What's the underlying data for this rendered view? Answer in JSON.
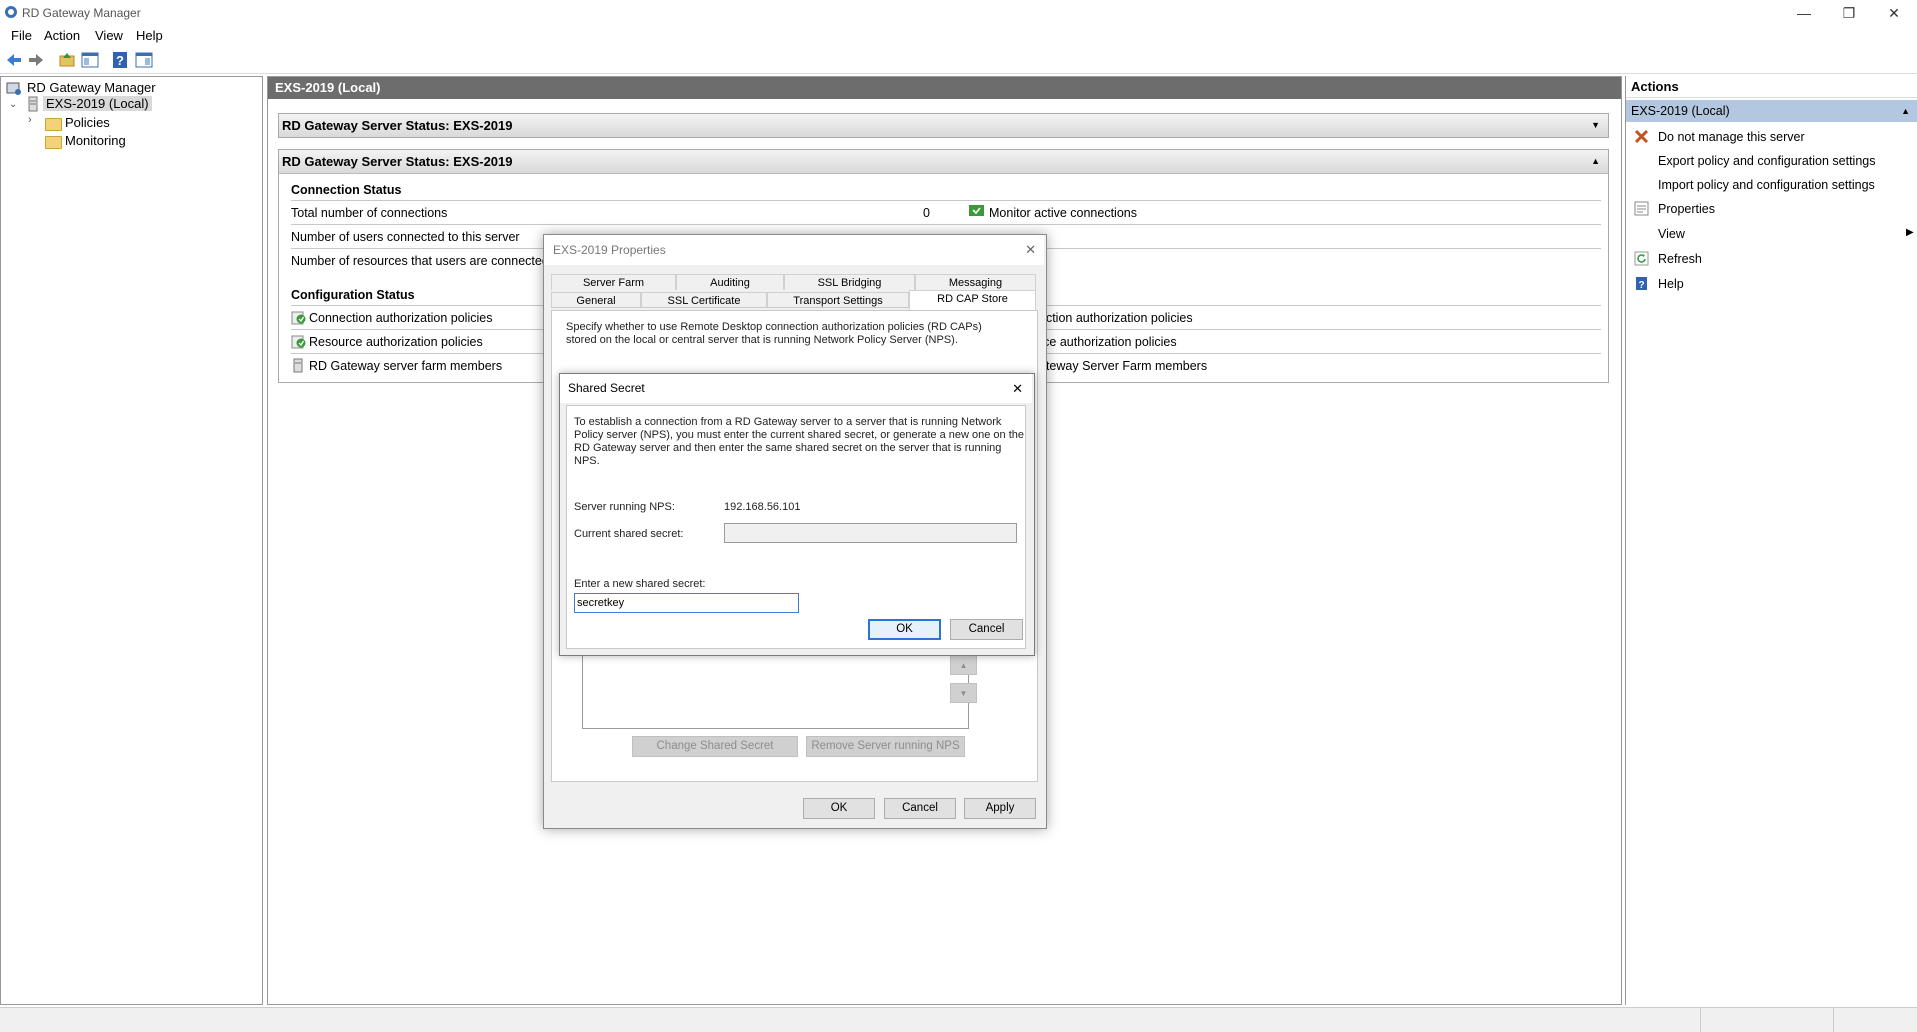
{
  "window": {
    "title": "RD Gateway Manager",
    "minimize": "—",
    "restore": "❐",
    "close": "✕"
  },
  "menu": {
    "file": "File",
    "action": "Action",
    "view": "View",
    "help": "Help"
  },
  "tree": {
    "root": "RD Gateway Manager",
    "server": "EXS-2019 (Local)",
    "policies": "Policies",
    "monitoring": "Monitoring"
  },
  "center": {
    "header": "EXS-2019 (Local)",
    "panel1_title": "RD Gateway Server Status: EXS-2019",
    "panel2_title": "RD Gateway Server Status: EXS-2019",
    "connection_status": "Connection Status",
    "total_connections_label": "Total number of connections",
    "total_connections_value": "0",
    "monitor_link": "Monitor active connections",
    "users_connected": "Number of users connected to this server",
    "resources_connected": "Number of resources that users are connected to",
    "config_status": "Configuration Status",
    "cap_policies": "Connection authorization policies",
    "rap_policies": "Resource authorization policies",
    "farm_members": "RD Gateway server farm members",
    "cap_link_tail": "ection authorization policies",
    "rap_link_tail": "rce authorization policies",
    "farm_link_tail": "ateway Server Farm members"
  },
  "actions": {
    "header": "Actions",
    "section": "EXS-2019 (Local)",
    "items": [
      {
        "label": "Do not manage this server",
        "icon": "x-icon"
      },
      {
        "label": "Export policy and configuration settings",
        "icon": ""
      },
      {
        "label": "Import policy and configuration settings",
        "icon": ""
      },
      {
        "label": "Properties",
        "icon": "properties-icon"
      },
      {
        "label": "View",
        "icon": ""
      },
      {
        "label": "Refresh",
        "icon": "refresh-icon"
      },
      {
        "label": "Help",
        "icon": "help-icon"
      }
    ]
  },
  "properties_dialog": {
    "title": "EXS-2019 Properties",
    "tabs_row1": [
      "Server Farm",
      "Auditing",
      "SSL Bridging",
      "Messaging"
    ],
    "tabs_row2": [
      "General",
      "SSL Certificate",
      "Transport Settings",
      "RD CAP Store"
    ],
    "selected_tab": "RD CAP Store",
    "description_line1": "Specify whether to use Remote Desktop connection authorization policies (RD CAPs)",
    "description_line2": "stored on the local or central server that is running Network Policy Server (NPS).",
    "change_secret_btn": "Change Shared Secret",
    "remove_server_btn": "Remove Server running NPS",
    "ok": "OK",
    "cancel": "Cancel",
    "apply": "Apply"
  },
  "secret_dialog": {
    "title": "Shared Secret",
    "intro_line1": "To establish a connection from a RD Gateway server to a server that is running Network",
    "intro_line2": "Policy server (NPS), you must enter the current shared secret, or generate a new one on the",
    "intro_line3": "RD Gateway server and then enter the same shared secret on the server that is running NPS.",
    "server_label": "Server running NPS:",
    "server_value": "192.168.56.101",
    "current_label": "Current shared secret:",
    "current_value": "",
    "new_label": "Enter a new shared secret:",
    "new_value": "secretkey",
    "ok": "OK",
    "cancel": "Cancel"
  }
}
